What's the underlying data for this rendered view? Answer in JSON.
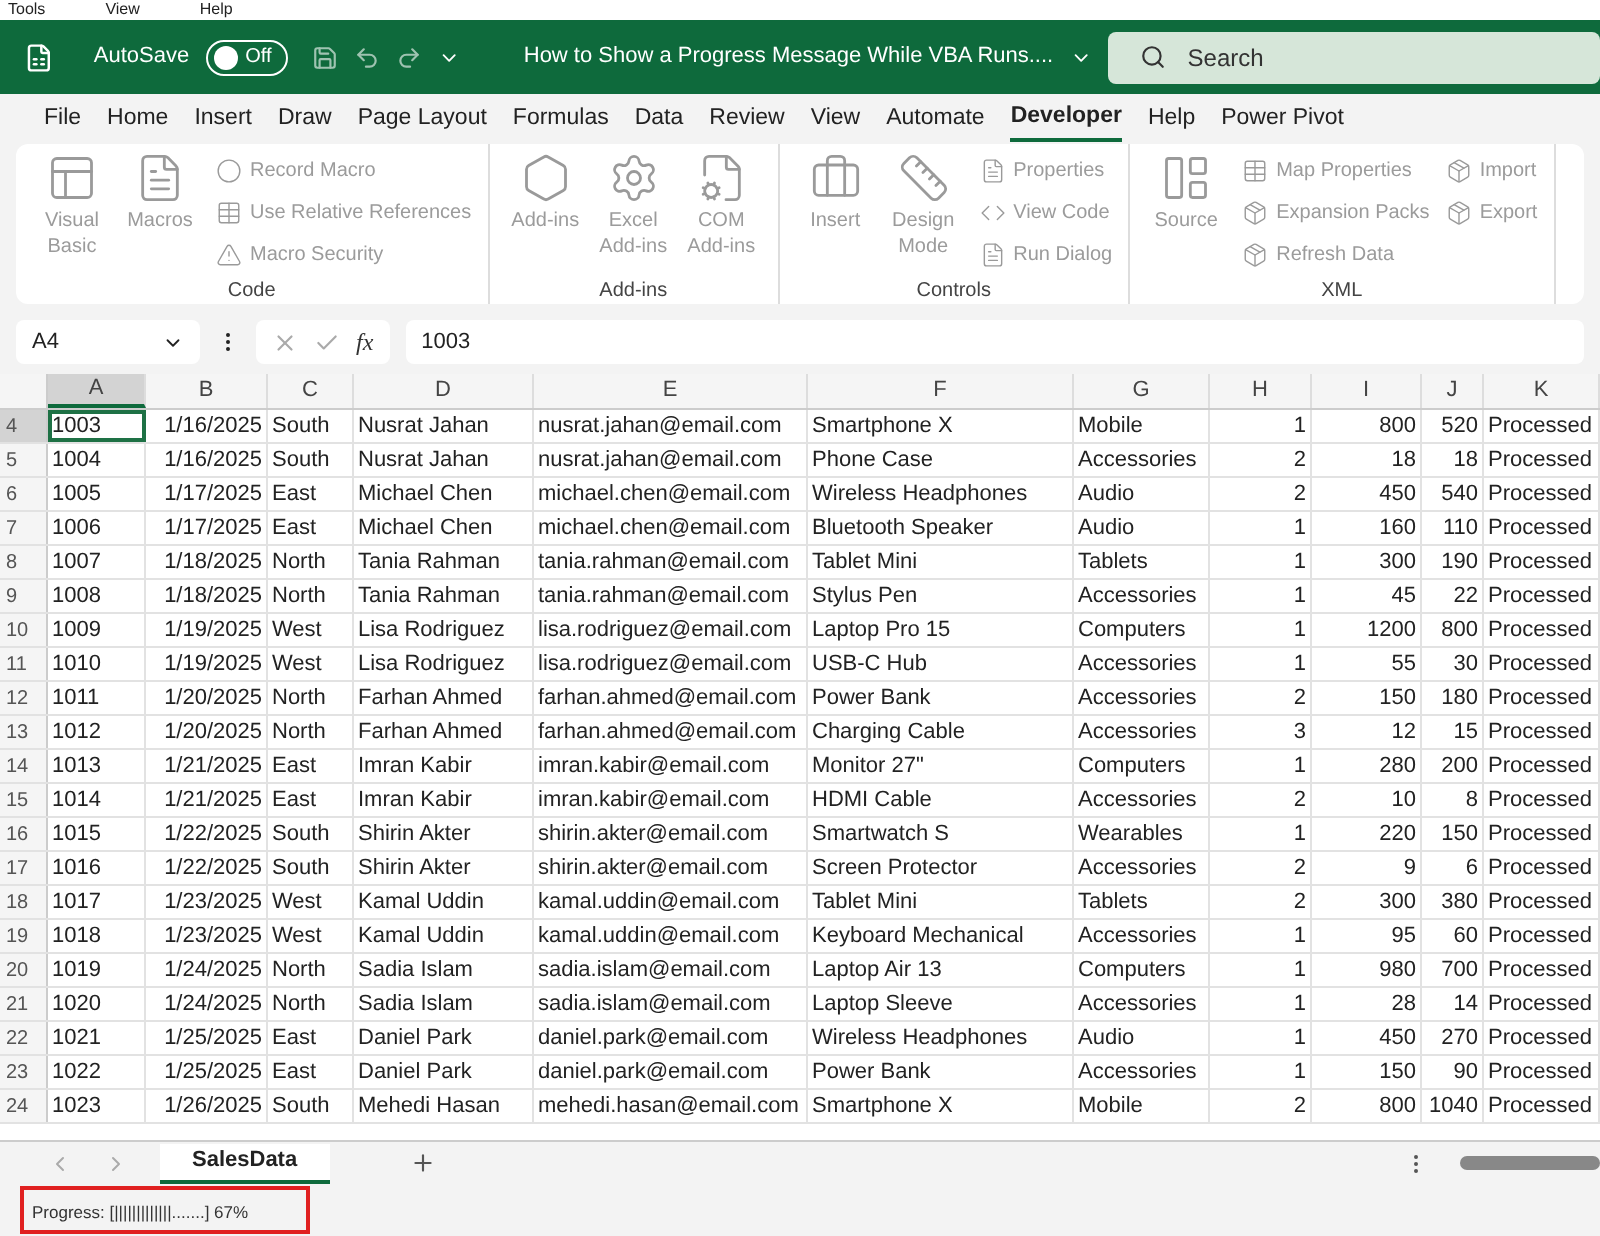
{
  "menu": [
    "Tools",
    "View",
    "Help"
  ],
  "title_bar": {
    "autosave_label": "AutoSave",
    "autosave": {
      "on": false,
      "label": "Off"
    },
    "title": "How to Show a Progress Message While VBA Runs....",
    "search": {
      "placeholder": "Search"
    }
  },
  "tabs": [
    {
      "label": "File",
      "selected": false
    },
    {
      "label": "Home",
      "selected": false
    },
    {
      "label": "Insert",
      "selected": false
    },
    {
      "label": "Draw",
      "selected": false
    },
    {
      "label": "Page Layout",
      "selected": false
    },
    {
      "label": "Formulas",
      "selected": false
    },
    {
      "label": "Data",
      "selected": false
    },
    {
      "label": "Review",
      "selected": false
    },
    {
      "label": "View",
      "selected": false
    },
    {
      "label": "Automate",
      "selected": false
    },
    {
      "label": "Developer",
      "selected": true
    },
    {
      "label": "Help",
      "selected": false
    },
    {
      "label": "Power Pivot",
      "selected": false
    }
  ],
  "ribbon": {
    "disabled": true,
    "groups": [
      {
        "name": "Code",
        "large": [
          {
            "label": "Visual Basic"
          },
          {
            "label": "Macros"
          }
        ],
        "small": [
          [
            {
              "label": "Record Macro"
            },
            {
              "label": "Use Relative References"
            },
            {
              "label": "Macro Security"
            }
          ]
        ]
      },
      {
        "name": "Add-ins",
        "large": [
          {
            "label": "Add-ins"
          },
          {
            "label": "Excel Add-ins"
          },
          {
            "label": "COM Add-ins"
          }
        ]
      },
      {
        "name": "Controls",
        "large": [
          {
            "label": "Insert"
          },
          {
            "label": "Design Mode"
          }
        ],
        "small": [
          [
            {
              "label": "Properties"
            },
            {
              "label": "View Code"
            },
            {
              "label": "Run Dialog"
            }
          ]
        ]
      },
      {
        "name": "XML",
        "large": [
          {
            "label": "Source"
          }
        ],
        "small": [
          [
            {
              "label": "Map Properties"
            },
            {
              "label": "Expansion Packs"
            },
            {
              "label": "Refresh Data"
            }
          ],
          [
            {
              "label": "Import"
            },
            {
              "label": "Export"
            }
          ]
        ]
      }
    ]
  },
  "formula_bar": {
    "name_box": "A4",
    "function_label": "fx",
    "formula": "1003"
  },
  "columns": [
    {
      "label": "A",
      "selected": true
    },
    {
      "label": "B",
      "selected": false
    },
    {
      "label": "C",
      "selected": false
    },
    {
      "label": "D",
      "selected": false
    },
    {
      "label": "E",
      "selected": false
    },
    {
      "label": "F",
      "selected": false
    },
    {
      "label": "G",
      "selected": false
    },
    {
      "label": "H",
      "selected": false
    },
    {
      "label": "I",
      "selected": false
    },
    {
      "label": "J",
      "selected": false
    },
    {
      "label": "K",
      "selected": false
    }
  ],
  "rows": [
    {
      "number": "4",
      "selected": true,
      "cells": [
        "1003",
        "1/16/2025",
        "South",
        "Nusrat Jahan",
        "nusrat.jahan@email.com",
        "Smartphone X",
        "Mobile",
        "1",
        "800",
        "520",
        "Processed"
      ]
    },
    {
      "number": "5",
      "selected": false,
      "cells": [
        "1004",
        "1/16/2025",
        "South",
        "Nusrat Jahan",
        "nusrat.jahan@email.com",
        "Phone Case",
        "Accessories",
        "2",
        "18",
        "18",
        "Processed"
      ]
    },
    {
      "number": "6",
      "selected": false,
      "cells": [
        "1005",
        "1/17/2025",
        "East",
        "Michael Chen",
        "michael.chen@email.com",
        "Wireless Headphones",
        "Audio",
        "2",
        "450",
        "540",
        "Processed"
      ]
    },
    {
      "number": "7",
      "selected": false,
      "cells": [
        "1006",
        "1/17/2025",
        "East",
        "Michael Chen",
        "michael.chen@email.com",
        "Bluetooth Speaker",
        "Audio",
        "1",
        "160",
        "110",
        "Processed"
      ]
    },
    {
      "number": "8",
      "selected": false,
      "cells": [
        "1007",
        "1/18/2025",
        "North",
        "Tania Rahman",
        "tania.rahman@email.com",
        "Tablet Mini",
        "Tablets",
        "1",
        "300",
        "190",
        "Processed"
      ]
    },
    {
      "number": "9",
      "selected": false,
      "cells": [
        "1008",
        "1/18/2025",
        "North",
        "Tania Rahman",
        "tania.rahman@email.com",
        "Stylus Pen",
        "Accessories",
        "1",
        "45",
        "22",
        "Processed"
      ]
    },
    {
      "number": "10",
      "selected": false,
      "cells": [
        "1009",
        "1/19/2025",
        "West",
        "Lisa Rodriguez",
        "lisa.rodriguez@email.com",
        "Laptop Pro 15",
        "Computers",
        "1",
        "1200",
        "800",
        "Processed"
      ]
    },
    {
      "number": "11",
      "selected": false,
      "cells": [
        "1010",
        "1/19/2025",
        "West",
        "Lisa Rodriguez",
        "lisa.rodriguez@email.com",
        "USB-C Hub",
        "Accessories",
        "1",
        "55",
        "30",
        "Processed"
      ]
    },
    {
      "number": "12",
      "selected": false,
      "cells": [
        "1011",
        "1/20/2025",
        "North",
        "Farhan Ahmed",
        "farhan.ahmed@email.com",
        "Power Bank",
        "Accessories",
        "2",
        "150",
        "180",
        "Processed"
      ]
    },
    {
      "number": "13",
      "selected": false,
      "cells": [
        "1012",
        "1/20/2025",
        "North",
        "Farhan Ahmed",
        "farhan.ahmed@email.com",
        "Charging Cable",
        "Accessories",
        "3",
        "12",
        "15",
        "Processed"
      ]
    },
    {
      "number": "14",
      "selected": false,
      "cells": [
        "1013",
        "1/21/2025",
        "East",
        "Imran Kabir",
        "imran.kabir@email.com",
        "Monitor 27\"",
        "Computers",
        "1",
        "280",
        "200",
        "Processed"
      ]
    },
    {
      "number": "15",
      "selected": false,
      "cells": [
        "1014",
        "1/21/2025",
        "East",
        "Imran Kabir",
        "imran.kabir@email.com",
        "HDMI Cable",
        "Accessories",
        "2",
        "10",
        "8",
        "Processed"
      ]
    },
    {
      "number": "16",
      "selected": false,
      "cells": [
        "1015",
        "1/22/2025",
        "South",
        "Shirin Akter",
        "shirin.akter@email.com",
        "Smartwatch S",
        "Wearables",
        "1",
        "220",
        "150",
        "Processed"
      ]
    },
    {
      "number": "17",
      "selected": false,
      "cells": [
        "1016",
        "1/22/2025",
        "South",
        "Shirin Akter",
        "shirin.akter@email.com",
        "Screen Protector",
        "Accessories",
        "2",
        "9",
        "6",
        "Processed"
      ]
    },
    {
      "number": "18",
      "selected": false,
      "cells": [
        "1017",
        "1/23/2025",
        "West",
        "Kamal Uddin",
        "kamal.uddin@email.com",
        "Tablet Mini",
        "Tablets",
        "2",
        "300",
        "380",
        "Processed"
      ]
    },
    {
      "number": "19",
      "selected": false,
      "cells": [
        "1018",
        "1/23/2025",
        "West",
        "Kamal Uddin",
        "kamal.uddin@email.com",
        "Keyboard Mechanical",
        "Accessories",
        "1",
        "95",
        "60",
        "Processed"
      ]
    },
    {
      "number": "20",
      "selected": false,
      "cells": [
        "1019",
        "1/24/2025",
        "North",
        "Sadia Islam",
        "sadia.islam@email.com",
        "Laptop Air 13",
        "Computers",
        "1",
        "980",
        "700",
        "Processed"
      ]
    },
    {
      "number": "21",
      "selected": false,
      "cells": [
        "1020",
        "1/24/2025",
        "North",
        "Sadia Islam",
        "sadia.islam@email.com",
        "Laptop Sleeve",
        "Accessories",
        "1",
        "28",
        "14",
        "Processed"
      ]
    },
    {
      "number": "22",
      "selected": false,
      "cells": [
        "1021",
        "1/25/2025",
        "East",
        "Daniel Park",
        "daniel.park@email.com",
        "Wireless Headphones",
        "Audio",
        "1",
        "450",
        "270",
        "Processed"
      ]
    },
    {
      "number": "23",
      "selected": false,
      "cells": [
        "1022",
        "1/25/2025",
        "East",
        "Daniel Park",
        "daniel.park@email.com",
        "Power Bank",
        "Accessories",
        "1",
        "150",
        "90",
        "Processed"
      ]
    },
    {
      "number": "24",
      "selected": false,
      "cells": [
        "1023",
        "1/26/2025",
        "South",
        "Mehedi Hasan",
        "mehedi.hasan@email.com",
        "Smartphone X",
        "Mobile",
        "2",
        "800",
        "1040",
        "Processed"
      ]
    }
  ],
  "sheet_tabs": [
    {
      "label": "SalesData",
      "selected": true
    }
  ],
  "status_bar": {
    "progress": "Progress: [|||||||||||||.......] 67%"
  }
}
